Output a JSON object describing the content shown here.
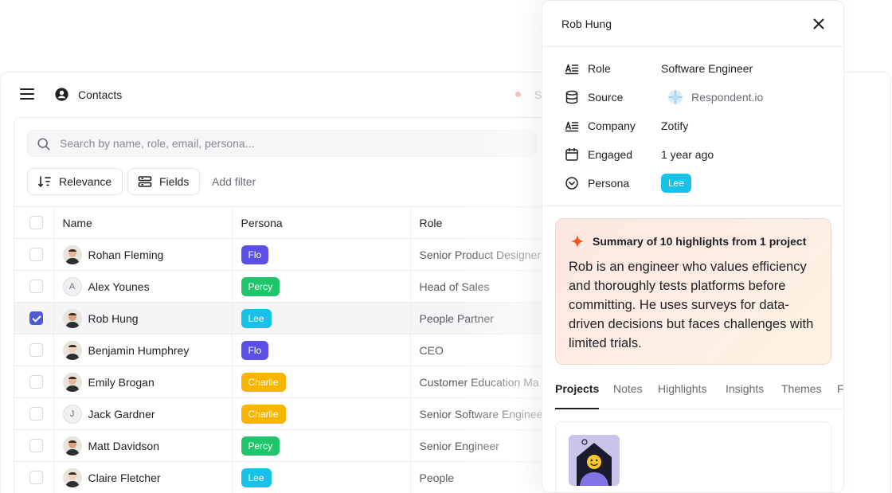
{
  "contacts": {
    "title": "Contacts",
    "status_text": "Sy",
    "search_placeholder": "Search by name, role, email, persona...",
    "toolbar": {
      "relevance_label": "Relevance",
      "fields_label": "Fields",
      "add_filter_label": "Add filter"
    },
    "columns": [
      "Name",
      "Persona",
      "Role"
    ],
    "rows": [
      {
        "name": "Rohan Fleming",
        "persona": "Flo",
        "role": "Senior Product Designer",
        "avatar": "photo",
        "checked": false
      },
      {
        "name": "Alex Younes",
        "persona": "Percy",
        "role": "Head of Sales",
        "avatar": "A",
        "checked": false
      },
      {
        "name": "Rob Hung",
        "persona": "Lee",
        "role": "People Partner",
        "avatar": "photo",
        "checked": true
      },
      {
        "name": "Benjamin Humphrey",
        "persona": "Flo",
        "role": "CEO",
        "avatar": "photo",
        "checked": false
      },
      {
        "name": "Emily Brogan",
        "persona": "Charlie",
        "role": "Customer Education Ma",
        "avatar": "photo",
        "checked": false
      },
      {
        "name": "Jack Gardner",
        "persona": "Charlie",
        "role": "Senior Software Engineer",
        "avatar": "J",
        "checked": false
      },
      {
        "name": "Matt Davidson",
        "persona": "Percy",
        "role": "Senior Engineer",
        "avatar": "photo",
        "checked": false
      },
      {
        "name": "Claire Fletcher",
        "persona": "Lee",
        "role": "People",
        "avatar": "photo",
        "checked": false
      }
    ]
  },
  "persona_colors": {
    "Flo": "#5b50e6",
    "Percy": "#1fc46b",
    "Lee": "#16c2e8",
    "Charlie": "#f7b500"
  },
  "detail": {
    "title": "Rob Hung",
    "properties": {
      "role_label": "Role",
      "role_value": "Software Engineer",
      "source_label": "Source",
      "source_value": "Respondent.io",
      "company_label": "Company",
      "company_value": "Zotify",
      "engaged_label": "Engaged",
      "engaged_value": "1 year ago",
      "persona_label": "Persona",
      "persona_value": "Lee"
    },
    "summary": {
      "heading": "Summary of 10 highlights from 1 project",
      "body": "Rob is an engineer who values efficiency and thoroughly tests platforms before committing. He uses surveys for data-driven decisions but faces challenges with limited trials."
    },
    "tabs": [
      "Projects",
      "Notes",
      "Highlights",
      "Insights",
      "Themes",
      "F"
    ]
  },
  "icons": {
    "menu": "hamburger-icon",
    "contacts": "user-circle-icon",
    "search": "search-icon",
    "sort": "sort-icon",
    "fields": "fields-icon",
    "close": "close-icon",
    "role": "text-lines-icon",
    "source": "database-icon",
    "company": "text-lines-icon",
    "engaged": "calendar-icon",
    "persona": "chevron-circle-icon",
    "summary": "sparkle-icon"
  }
}
